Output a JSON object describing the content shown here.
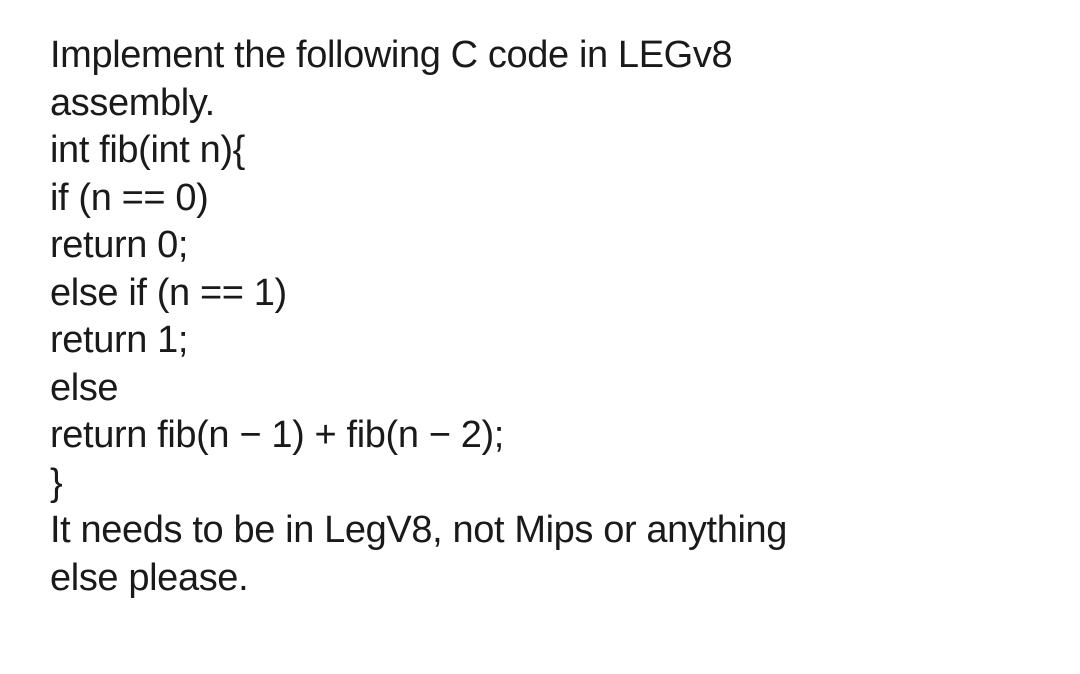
{
  "problem": {
    "intro_line_1": "Implement the following C code in LEGv8",
    "intro_line_2": "assembly.",
    "code": {
      "line_1": "int fib(int n){",
      "line_2": "if (n == 0)",
      "line_3": "return 0;",
      "line_4": "else if (n == 1)",
      "line_5": "return 1;",
      "line_6": "else",
      "line_7": "return fib(n − 1) + fib(n − 2);",
      "line_8": "}"
    },
    "note_line_1": "It needs to be in LegV8, not Mips or anything",
    "note_line_2": "else please."
  }
}
